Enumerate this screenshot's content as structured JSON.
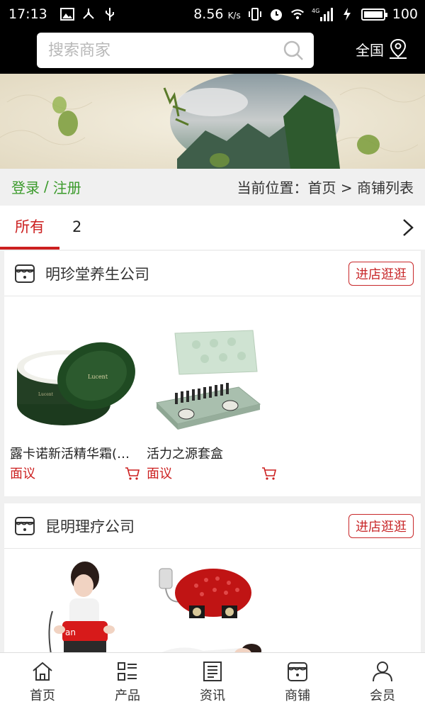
{
  "status_bar": {
    "time": "17:13",
    "speed": "8.56",
    "speed_unit": "K/s",
    "network_label": "4G",
    "battery": "100"
  },
  "header": {
    "search_placeholder": "搜索商家",
    "region_label": "全国"
  },
  "breadcrumb": {
    "login": "登录",
    "separator": "/",
    "register": "注册",
    "position_label": "当前位置：首页 > 商铺列表"
  },
  "tabs": {
    "all": "所有",
    "second": "2"
  },
  "shops": [
    {
      "name": "明珍堂养生公司",
      "visit_label": "进店逛逛",
      "products": [
        {
          "name": "露卡诺新活精华霜(…",
          "price": "面议"
        },
        {
          "name": "活力之源套盒",
          "price": "面议"
        }
      ]
    },
    {
      "name": "昆明理疗公司",
      "visit_label": "进店逛逛",
      "products": [
        {
          "name": "",
          "price": ""
        },
        {
          "name": "",
          "price": ""
        }
      ]
    }
  ],
  "bottom_nav": [
    {
      "label": "首页",
      "icon": "home-icon"
    },
    {
      "label": "产品",
      "icon": "list-icon"
    },
    {
      "label": "资讯",
      "icon": "news-icon"
    },
    {
      "label": "商铺",
      "icon": "shop-icon"
    },
    {
      "label": "会员",
      "icon": "user-icon"
    }
  ],
  "colors": {
    "accent_red": "#cc1f1f",
    "login_green": "#3a9a2a",
    "header_bg": "#000000"
  }
}
